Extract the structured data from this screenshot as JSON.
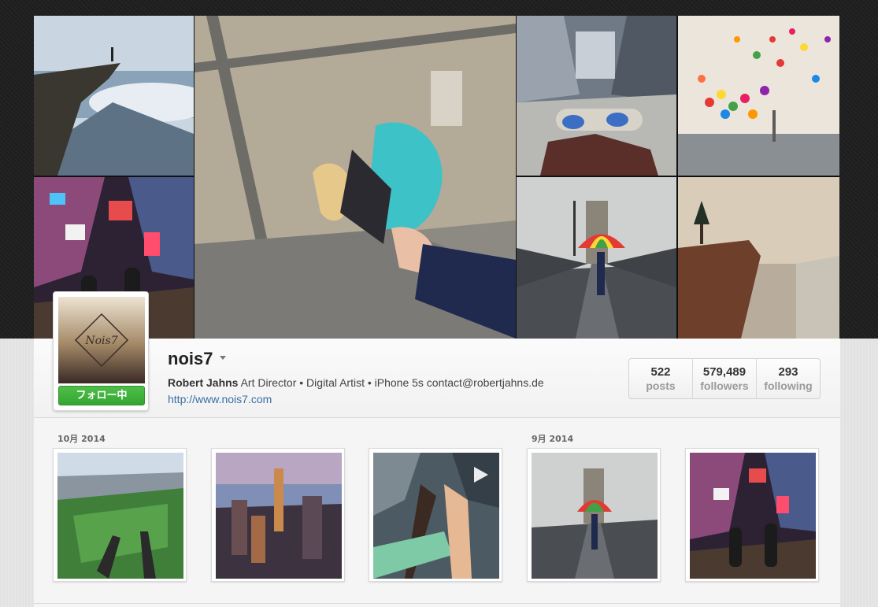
{
  "profile": {
    "username": "nois7",
    "full_name": "Robert Jahns",
    "bio": "Art Director • Digital Artist • iPhone 5s contact@robertjahns.de",
    "website": "http://www.nois7.com",
    "follow_label": "フォロー中",
    "avatar_logo_text": "Nois7"
  },
  "stats": [
    {
      "value": "522",
      "label": "posts"
    },
    {
      "value": "579,489",
      "label": "followers"
    },
    {
      "value": "293",
      "label": "following"
    }
  ],
  "feed": {
    "groups": [
      {
        "label": "10月 2014"
      },
      {
        "label": "9月 2014"
      }
    ]
  },
  "hero_tiles": [
    {
      "icon": "cliff-handstand-photo"
    },
    {
      "icon": "holding-hands-skyscraper-photo"
    },
    {
      "icon": "skateboard-rooftop-photo"
    },
    {
      "icon": "balloons-paris-photo"
    },
    {
      "icon": "times-square-feet-photo"
    },
    {
      "icon": "bridge-umbrella-photo"
    },
    {
      "icon": "cliff-tree-photo"
    }
  ],
  "thumbnails": [
    {
      "icon": "central-park-feet-photo"
    },
    {
      "icon": "empire-state-skyline-photo"
    },
    {
      "icon": "selfie-stick-rooftop-video",
      "video": true
    },
    {
      "icon": "bridge-umbrella-photo"
    },
    {
      "icon": "times-square-feet-photo"
    }
  ],
  "colors": {
    "follow_green": "#3cb035",
    "link_blue": "#3b6ea5"
  }
}
